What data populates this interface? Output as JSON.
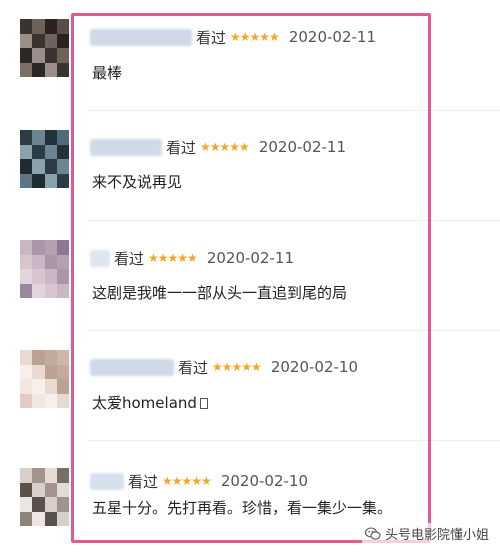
{
  "reviews": [
    {
      "watched_label": "看过",
      "stars": "★★★★★",
      "rating": 5,
      "date": "2020-02-11",
      "comment": "最棒",
      "avatar_palette": [
        "#3a3330",
        "#5a4d47",
        "#2c2624",
        "#6e625a",
        "#4a403b",
        "#9b8e86",
        "#2a2320",
        "#7c6f67"
      ]
    },
    {
      "watched_label": "看过",
      "stars": "★★★★★",
      "rating": 5,
      "date": "2020-02-11",
      "comment": "来不及说再见",
      "avatar_palette": [
        "#2b3c46",
        "#4f6c7b",
        "#1f2a31",
        "#6b8592",
        "#3c5563",
        "#8aa2ad",
        "#253139",
        "#5d7684"
      ]
    },
    {
      "watched_label": "看过",
      "stars": "★★★★★",
      "rating": 5,
      "date": "2020-02-11",
      "comment": "这剧是我唯一一部从头一直追到尾的局",
      "avatar_palette": [
        "#c9b7c3",
        "#8b7a93",
        "#e2d4dc",
        "#a897a8",
        "#6f5f74",
        "#d8c6cf",
        "#b3a1b2",
        "#9a899e"
      ]
    },
    {
      "watched_label": "看过",
      "stars": "★★★★★",
      "rating": 5,
      "date": "2020-02-10",
      "comment": "太爱homeland",
      "avatar_palette": [
        "#e8d9d3",
        "#cfb6aa",
        "#f2e6e1",
        "#bca195",
        "#dcc5bb",
        "#f7efeb",
        "#c4a99d",
        "#e1cdc4"
      ]
    },
    {
      "watched_label": "看过",
      "stars": "★★★★★",
      "rating": 5,
      "date": "2020-02-10",
      "comment": "五星十分。先打再看。珍惜，看一集少一集。",
      "avatar_palette": [
        "#d8cfc9",
        "#7a6d66",
        "#ece6e2",
        "#a2948c",
        "#c2b6ae",
        "#5c504a",
        "#e3dbd6",
        "#8f827b"
      ]
    }
  ],
  "watermark": {
    "text": "头号电影院懂小姐"
  },
  "colors": {
    "star": "#f5a623",
    "highlight_frame": "#e25a8f",
    "username_blur": "#c9d6e8"
  }
}
